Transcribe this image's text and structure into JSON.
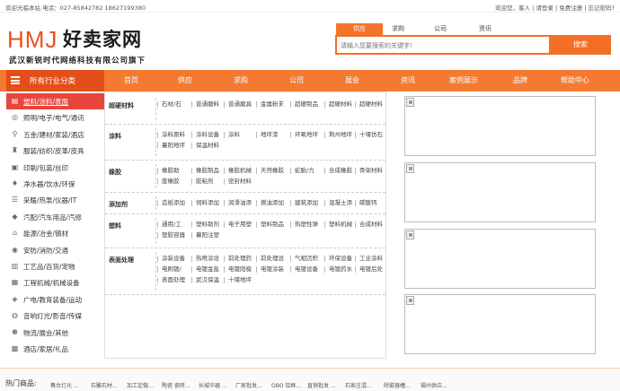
{
  "topbar": {
    "left_text": "欢迎光临本站 电话：027-85842782 18627199380",
    "welcome": "欢迎您，",
    "guest": "客人",
    "login": "请登录",
    "register": "免费注册",
    "forgot": "忘记密码?"
  },
  "logo": {
    "en": "HMJ",
    "cn": "好卖家网",
    "slogan": "武汉新锐时代网络科技有限公司旗下"
  },
  "search": {
    "tabs": [
      "供应",
      "求购",
      "公司",
      "资讯"
    ],
    "active_tab": "供应",
    "placeholder": "请输入您要搜索的关键字!",
    "button": "搜索"
  },
  "nav": {
    "all_label": "所有行业分类",
    "items": [
      "首页",
      "供应",
      "求购",
      "公司",
      "展会",
      "资讯",
      "案例展示",
      "品牌",
      "帮助中心"
    ]
  },
  "categories": [
    {
      "label": "塑料/涂料/表面",
      "icon": "plastic-icon"
    },
    {
      "label": "照明/电子/电气/通讯",
      "icon": "light-icon"
    },
    {
      "label": "五金/建材/家装/酒店",
      "icon": "hardware-icon"
    },
    {
      "label": "服装/纺织/皮革/皮具",
      "icon": "clothes-icon"
    },
    {
      "label": "印刷/包装/丝印",
      "icon": "print-icon"
    },
    {
      "label": "净水器/饮水/环保",
      "icon": "water-icon"
    },
    {
      "label": "采暖/热泵/仪器/IT",
      "icon": "heating-icon"
    },
    {
      "label": "汽配/汽车用品/汽修",
      "icon": "car-icon"
    },
    {
      "label": "能源/冶金/钢材",
      "icon": "energy-icon"
    },
    {
      "label": "安防/消防/交通",
      "icon": "security-icon"
    },
    {
      "label": "工艺品/百货/宠物",
      "icon": "craft-icon"
    },
    {
      "label": "工程机械/机械设备",
      "icon": "machine-icon"
    },
    {
      "label": "广电/教育装备/运动",
      "icon": "tv-icon"
    },
    {
      "label": "音响灯光/影音/传媒",
      "icon": "audio-icon"
    },
    {
      "label": "物流/展会/其他",
      "icon": "logistics-icon"
    },
    {
      "label": "酒店/家居/礼品",
      "icon": "hotel-icon"
    }
  ],
  "panel": {
    "rows": [
      {
        "title": "超硬材料",
        "items": [
          [
            "石材/石",
            "普通磨料",
            "普通磨具",
            "金属粉末",
            "超硬制品",
            "超硬材料",
            "超硬材料"
          ]
        ]
      },
      {
        "title": "涂料",
        "items": [
          [
            "涂料原料",
            "涂料设备",
            "涂料",
            "地坪漆",
            "环氧地坪",
            "荆州地坪",
            "十堰仿石"
          ],
          [
            "襄阳地坪",
            "保温材料"
          ]
        ]
      },
      {
        "title": "橡胶",
        "items": [
          [
            "橡胶助",
            "橡胶制品",
            "橡胶机械",
            "天然橡胶",
            "蛇胎/力",
            "合成橡胶",
            "骨架材料"
          ],
          [
            "废橡胶",
            "胶粘剂",
            "密封材料"
          ]
        ]
      },
      {
        "title": "添加剂",
        "items": [
          [
            "造纸添加",
            "饲料添加",
            "润滑油添",
            "燃油添加",
            "建筑添加",
            "混凝土添",
            "碳酸钙"
          ]
        ]
      },
      {
        "title": "塑料",
        "items": [
          [
            "通用/工",
            "塑料助剂",
            "电子用塑",
            "塑料制品",
            "热塑性弹",
            "塑料机械",
            "合成材料"
          ],
          [
            "塑胶容器",
            "襄阳注塑"
          ]
        ]
      },
      {
        "title": "表面处理",
        "items": [
          [
            "涂装设备",
            "热喷涂设",
            "前处理药",
            "前处理设",
            "气相沉积",
            "环保设备",
            "工业涂料"
          ],
          [
            "电刷镀/",
            "电镀金盐",
            "电镀阳极",
            "电镀涂装",
            "电镀设备",
            "电镀药水",
            "电镀后处"
          ],
          [
            "表面处理",
            "武汉保温",
            "十堰地坪"
          ]
        ]
      }
    ]
  },
  "hot": {
    "label": "热门商品:",
    "items": [
      "舞台灯光 ...",
      "石雕石材...",
      "加工定做...",
      "陶瓷 瓷砖...",
      "长城华器 ...",
      "厂家批发...",
      "OBO 铝框...",
      "直销批发 ...",
      "石家庄混...",
      "除雾器槽...",
      "福州供应..."
    ]
  }
}
